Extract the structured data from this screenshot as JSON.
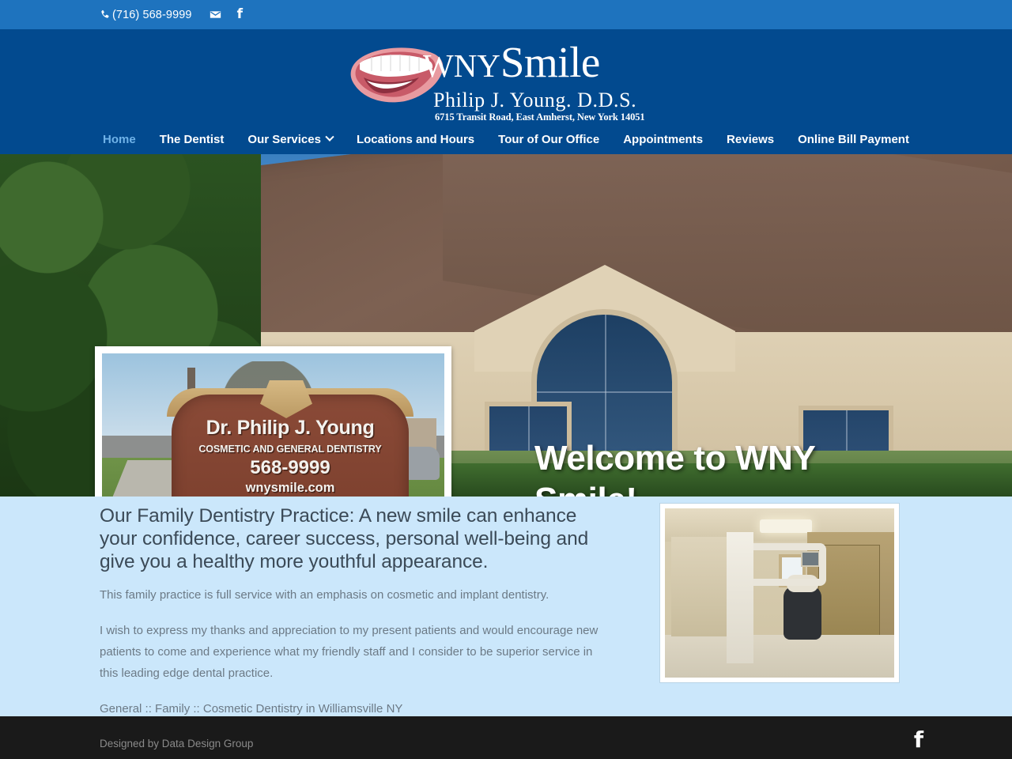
{
  "topbar": {
    "phone": "(716) 568-9999",
    "phone_icon": "phone-icon",
    "email_icon": "email-icon",
    "facebook_icon": "facebook-icon"
  },
  "logo": {
    "mouth_icon": "smiling-mouth-icon",
    "brand_wny": "WNY",
    "brand_smile": "Smile",
    "doctor": "Philip J. Young. D.D.S.",
    "address": "6715 Transit Road, East Amherst, New York 14051"
  },
  "nav": {
    "items": [
      {
        "label": "Home",
        "active": true,
        "has_dropdown": false
      },
      {
        "label": "The Dentist",
        "active": false,
        "has_dropdown": false
      },
      {
        "label": "Our Services",
        "active": false,
        "has_dropdown": true
      },
      {
        "label": "Locations and Hours",
        "active": false,
        "has_dropdown": false
      },
      {
        "label": "Tour of Our Office",
        "active": false,
        "has_dropdown": false
      },
      {
        "label": "Appointments",
        "active": false,
        "has_dropdown": false
      },
      {
        "label": "Reviews",
        "active": false,
        "has_dropdown": false
      },
      {
        "label": "Online Bill Payment",
        "active": false,
        "has_dropdown": false
      }
    ],
    "active_color": "#6fb2e8"
  },
  "hero": {
    "title": "Welcome to WNY Smile!",
    "background_alt": "dental-office-building-exterior",
    "sign": {
      "line1": "Dr. Philip J. Young",
      "line2": "COSMETIC AND GENERAL DENTISTRY",
      "line3": "568-9999",
      "line4": "wnysmile.com"
    }
  },
  "content": {
    "lead": "Our Family Dentistry Practice: A new smile can enhance your confidence, career success, personal well-being and give you a healthy more youthful appearance.",
    "paragraph1": "This family practice is full service with an emphasis on cosmetic and implant dentistry.",
    "paragraph2": "I wish to express my thanks and appreciation to my present patients and would encourage new patients to come and experience what my friendly staff and I consider to be superior service in this leading edge dental practice.",
    "paragraph3": "General  ::  Family :: Cosmetic Dentistry in Williamsville NY",
    "photo_alt": "dental-operatory-interior-photo",
    "background_color": "#cbe7fb"
  },
  "footer": {
    "credit": "Designed by Data Design Group",
    "facebook_icon": "facebook-icon",
    "background_color": "#1a1a1a"
  },
  "theme": {
    "topbar_blue": "#1e73be",
    "header_blue": "#024a8f",
    "accent_light_blue": "#6fb2e8"
  }
}
